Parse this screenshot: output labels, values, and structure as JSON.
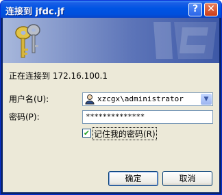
{
  "window": {
    "title": "连接到 jfdc.jf"
  },
  "titlebar": {
    "help_icon": "?",
    "close_icon": "✕"
  },
  "dialog": {
    "connect_text": "正在连接到 172.16.100.1",
    "username_label": "用户名(U):",
    "username_value": "xzcgx\\administrator",
    "password_label": "密码(P):",
    "password_value": "**************",
    "remember_label": "记住我的密码(R)",
    "remember_checked": "✔",
    "ok_label": "确定",
    "cancel_label": "取消"
  },
  "icons": {
    "banner": "keys-icon",
    "user": "user-icon",
    "dropdown": "chevron-down-icon"
  },
  "colors": {
    "titlebar": "#0054e3",
    "dialog_bg": "#ece9d8",
    "banner": "#5c74b8"
  }
}
